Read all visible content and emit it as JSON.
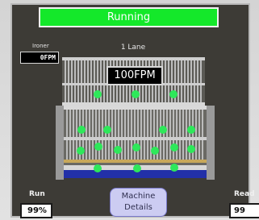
{
  "status": {
    "text": "Running",
    "color": "#14e82a"
  },
  "ironer": {
    "label": "Ironer",
    "speed": "0FPM"
  },
  "lane": {
    "label": "1 Lane"
  },
  "machine": {
    "speed": "100FPM",
    "indicator_color": "#2ee85a"
  },
  "stats": {
    "run": {
      "label": "Run",
      "value": "99%"
    },
    "ready": {
      "label": "Read",
      "value": "99"
    }
  },
  "buttons": {
    "machine_details": "Machine Details"
  }
}
